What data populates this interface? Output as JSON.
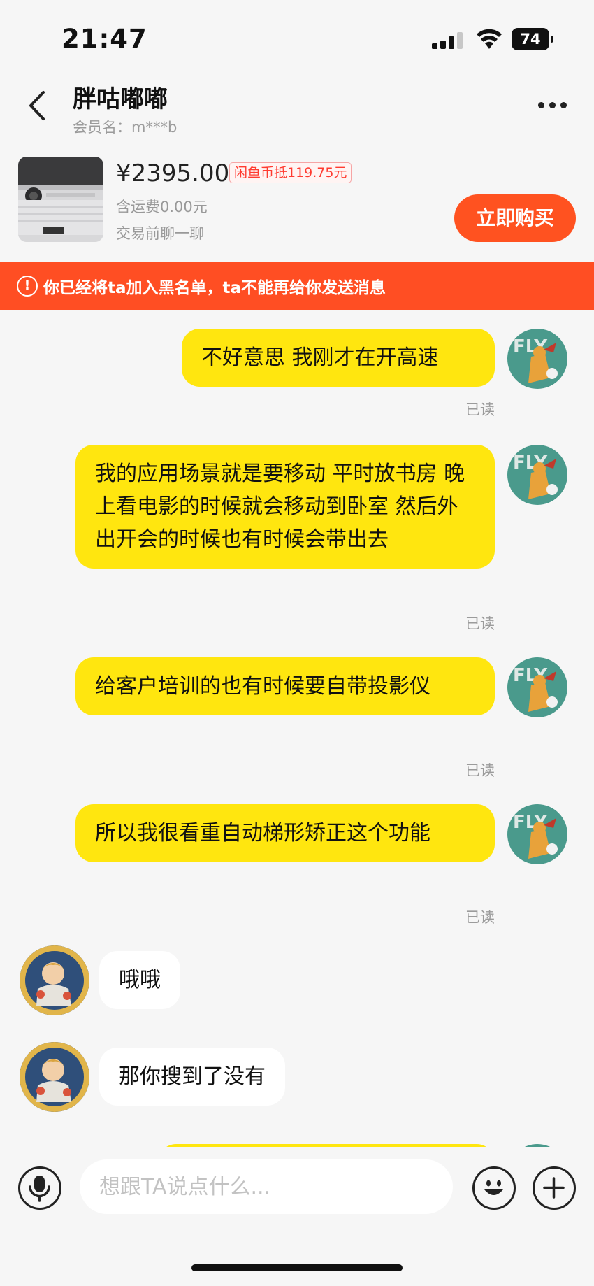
{
  "status_bar": {
    "time": "21:47",
    "battery": "74"
  },
  "header": {
    "title": "胖咕嘟嘟",
    "member_label": "会员名：m***b"
  },
  "product": {
    "price": "¥2395.00",
    "coin_badge": "闲鱼币抵119.75元",
    "shipping": "含运费0.00元",
    "chat_before": "交易前聊一聊",
    "buy_label": "立即购买"
  },
  "notice": {
    "icon": "!",
    "text": "你已经将ta加入黑名单，ta不能再给你发送消息"
  },
  "messages": [
    {
      "from": "me",
      "text": "不好意思 我刚才在开高速",
      "read": "已读"
    },
    {
      "from": "me",
      "text": "我的应用场景就是要移动 平时放书房 晚上看电影的时候就会移动到卧室 然后外出开会的时候也有时候会带出去",
      "read": "已读"
    },
    {
      "from": "me",
      "text": "给客户培训的也有时候要自带投影仪",
      "read": "已读"
    },
    {
      "from": "me",
      "text": "所以我很看重自动梯形矫正这个功能",
      "read": "已读"
    },
    {
      "from": "them",
      "text": "哦哦"
    },
    {
      "from": "them",
      "text": "那你搜到了没有"
    }
  ],
  "input": {
    "placeholder": "想跟TA说点什么..."
  },
  "icons": {
    "back": "chevron-left-icon",
    "more": "more-dots-icon",
    "mic": "microphone-icon",
    "emoji": "emoji-icon",
    "plus": "plus-icon",
    "warning": "warning-icon",
    "signal": "signal-icon",
    "wifi": "wifi-icon"
  },
  "colors": {
    "accent": "#ff5220",
    "bubble_me": "#ffe60f",
    "notice_bg": "#ff4e23",
    "badge_text": "#ff3b30"
  }
}
